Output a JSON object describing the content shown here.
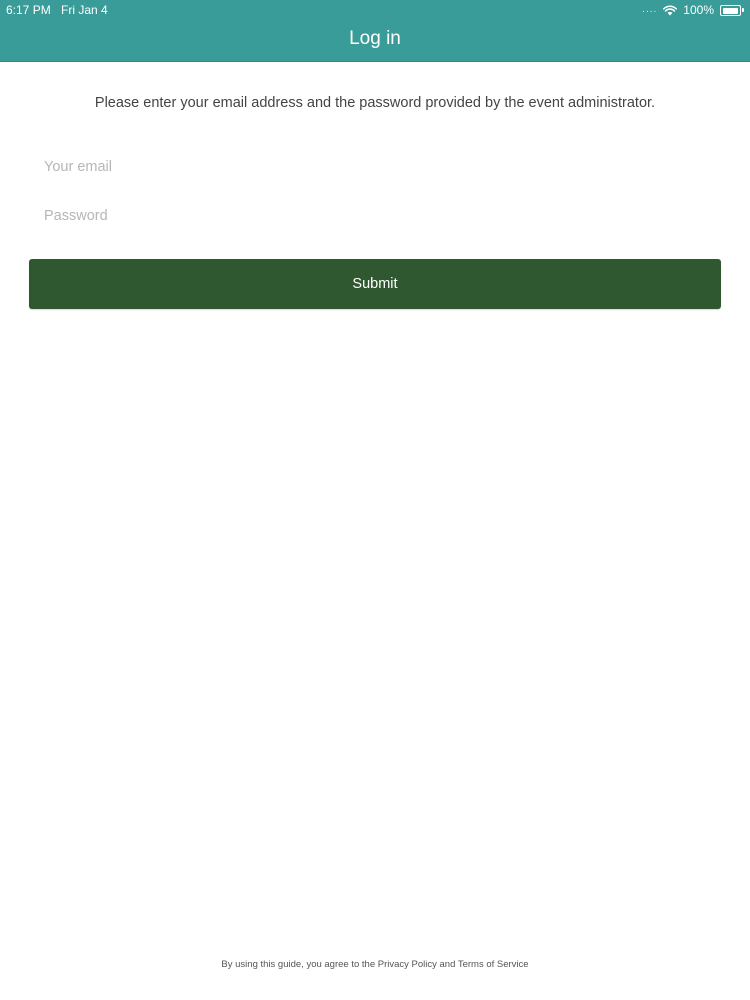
{
  "status_bar": {
    "time": "6:17 PM",
    "date": "Fri Jan 4",
    "signal": "....",
    "battery": "100%"
  },
  "header": {
    "title": "Log in",
    "background_color": "#3a9c98"
  },
  "form": {
    "instructions": "Please enter your email address and the password provided by the event administrator.",
    "email": {
      "placeholder": "Your email",
      "value": ""
    },
    "password": {
      "placeholder": "Password",
      "value": ""
    },
    "submit_label": "Submit",
    "submit_color": "#2f5730"
  },
  "footer": {
    "text": "By using this guide, you agree to the Privacy Policy and Terms of Service"
  },
  "icons": [
    "wifi-icon",
    "battery-icon"
  ]
}
